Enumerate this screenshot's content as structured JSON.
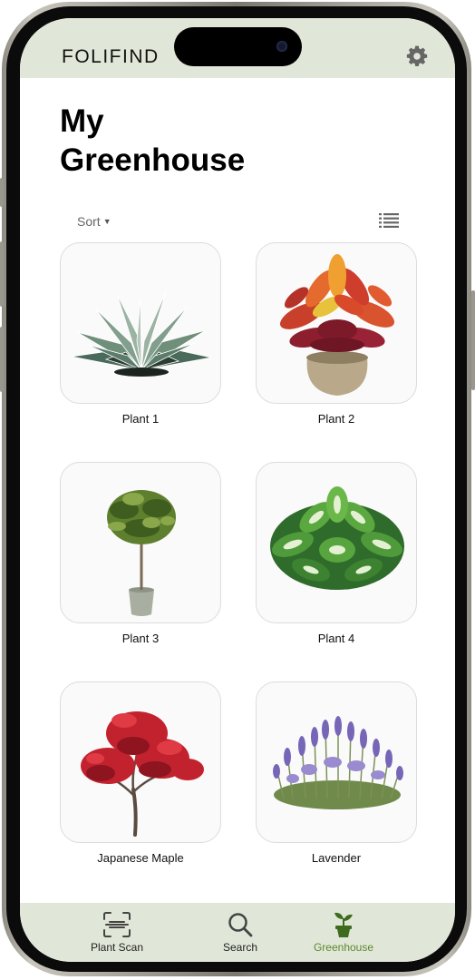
{
  "app": {
    "name": "FOLIFIND"
  },
  "page": {
    "title_line1": "My",
    "title_line2": "Greenhouse"
  },
  "controls": {
    "sort_label": "Sort"
  },
  "plants": [
    {
      "name": "Plant 1",
      "image": "agave-plant"
    },
    {
      "name": "Plant 2",
      "image": "croton-plant"
    },
    {
      "name": "Plant 3",
      "image": "potted-tree"
    },
    {
      "name": "Plant 4",
      "image": "dieffenbachia-plant"
    },
    {
      "name": "Japanese Maple",
      "image": "japanese-maple-tree"
    },
    {
      "name": "Lavender",
      "image": "lavender-bush"
    }
  ],
  "tabs": [
    {
      "label": "Plant Scan",
      "icon": "scan-icon",
      "active": false
    },
    {
      "label": "Search",
      "icon": "search-icon",
      "active": false
    },
    {
      "label": "Greenhouse",
      "icon": "sprout-pot-icon",
      "active": true
    }
  ],
  "colors": {
    "header_bg": "#e1e7d8",
    "tabbar_bg": "#e1e7d8",
    "accent": "#5b8a2e",
    "card_border": "#dcdcdc"
  }
}
